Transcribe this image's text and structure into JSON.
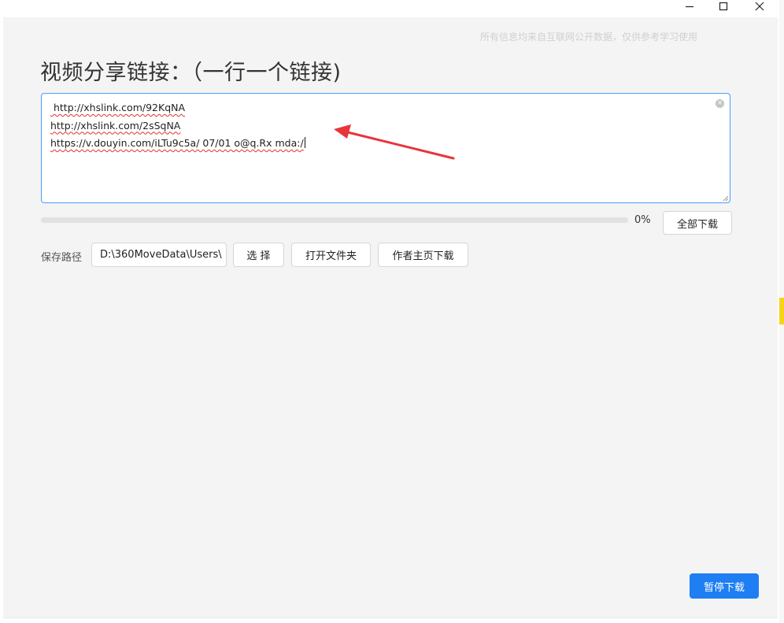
{
  "window": {
    "controls": {
      "minimize_icon": "minimize-icon",
      "maximize_icon": "maximize-icon",
      "close_icon": "close-icon"
    }
  },
  "notice": "所有信息均来自互联网公开数据，仅供参考学习使用",
  "heading": "视频分享链接：（一行一个链接)",
  "links": [
    " http://xhslink.com/92KqNA",
    "http://xhslink.com/2sSqNA",
    "https://v.douyin.com/iLTu9c5a/ 07/01 o@q.Rx mda:/"
  ],
  "progress": {
    "percent": 0,
    "text": "0%"
  },
  "buttons": {
    "download_all": "全部下载",
    "choose": "选 择",
    "open_folder": "打开文件夹",
    "author_download": "作者主页下载",
    "pause_download": "暂停下载"
  },
  "save_path": {
    "label": "保存路径",
    "value": "D:\\360MoveData\\Users\\"
  },
  "colors": {
    "accent": "#1e7ef2",
    "input_focus_border": "#4a9cff",
    "annotation_arrow": "#e8353b"
  }
}
